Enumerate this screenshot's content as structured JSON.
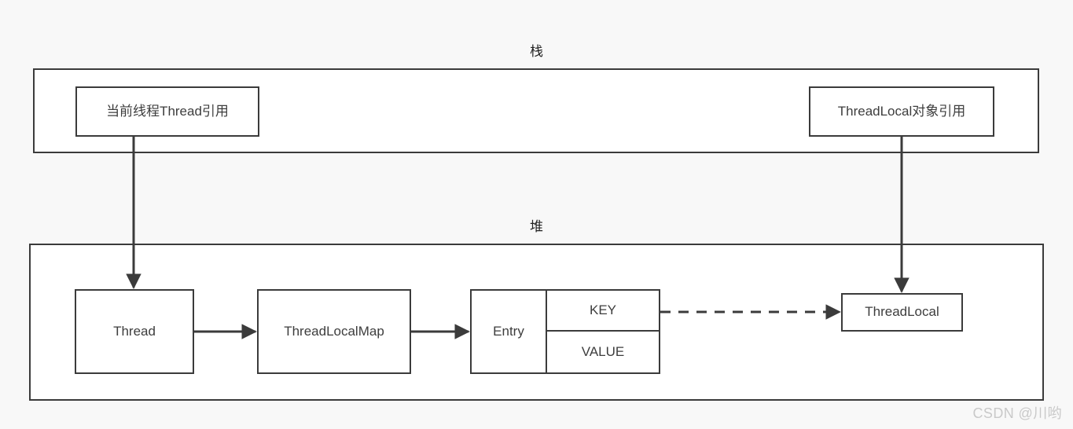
{
  "diagram": {
    "background_color": "#f8f8f8",
    "stroke_color": "#3b3b3b",
    "text_color": "#3d3d3d",
    "regions": [
      {
        "id": "stack",
        "label": "栈"
      },
      {
        "id": "heap",
        "label": "堆"
      }
    ],
    "stack_nodes": [
      {
        "id": "current-thread-ref",
        "label": "当前线程Thread引用"
      },
      {
        "id": "threadlocal-object-ref",
        "label": "ThreadLocal对象引用"
      }
    ],
    "heap_nodes": [
      {
        "id": "thread",
        "label": "Thread"
      },
      {
        "id": "threadlocalmap",
        "label": "ThreadLocalMap"
      },
      {
        "id": "entry",
        "label": "Entry"
      },
      {
        "id": "entry-key",
        "label": "KEY"
      },
      {
        "id": "entry-value",
        "label": "VALUE"
      },
      {
        "id": "threadlocal",
        "label": "ThreadLocal"
      }
    ],
    "connections": [
      {
        "from": "current-thread-ref",
        "to": "thread",
        "style": "solid",
        "direction": "down"
      },
      {
        "from": "threadlocal-object-ref",
        "to": "threadlocal",
        "style": "solid",
        "direction": "down"
      },
      {
        "from": "thread",
        "to": "threadlocalmap",
        "style": "solid",
        "direction": "right"
      },
      {
        "from": "threadlocalmap",
        "to": "entry",
        "style": "solid",
        "direction": "right"
      },
      {
        "from": "entry-key",
        "to": "threadlocal",
        "style": "dashed",
        "direction": "right"
      }
    ]
  },
  "watermark": {
    "text": "CSDN @川哟"
  }
}
